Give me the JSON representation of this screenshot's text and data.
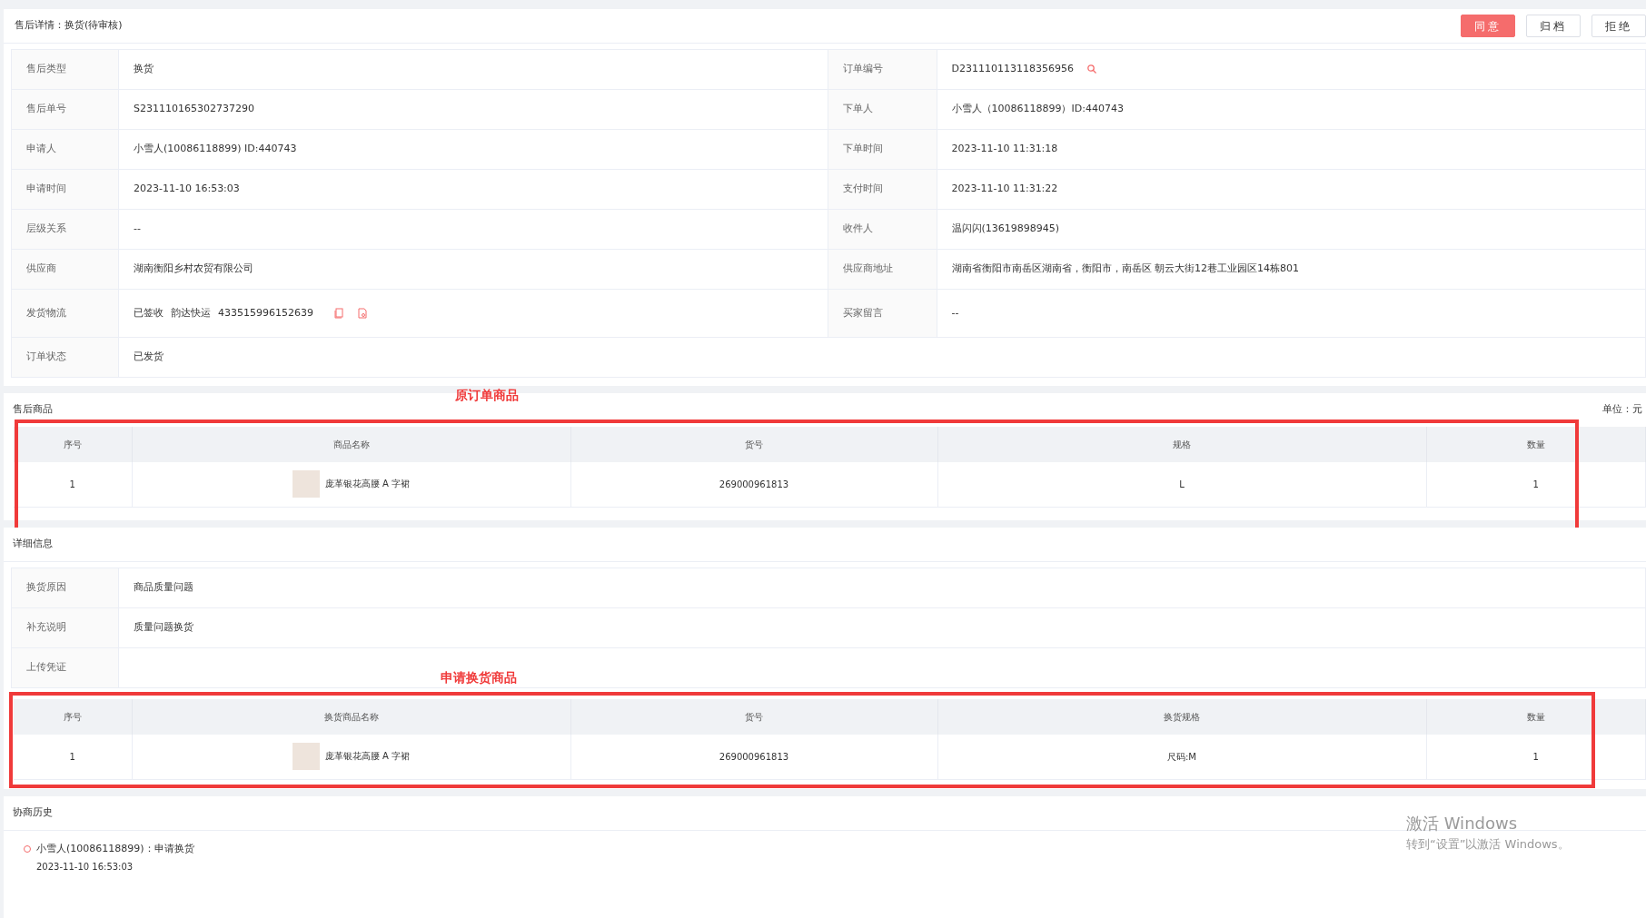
{
  "header": {
    "title": "售后详情：换货(待审核)",
    "buttons": [
      {
        "label": "同意",
        "kind": "primary"
      },
      {
        "label": "归档",
        "kind": "default"
      },
      {
        "label": "拒绝",
        "kind": "default"
      }
    ]
  },
  "info_rows": [
    {
      "cells": [
        {
          "label": "售后类型",
          "value": "换货"
        },
        {
          "label": "订单编号",
          "value": "D231110113118356956",
          "kind": "search"
        }
      ]
    },
    {
      "cells": [
        {
          "label": "售后单号",
          "value": "S231110165302737290"
        },
        {
          "label": "下单人",
          "value": "小雪人（10086118899）ID:440743"
        }
      ]
    },
    {
      "cells": [
        {
          "label": "申请人",
          "value": "小雪人(10086118899) ID:440743"
        },
        {
          "label": "下单时间",
          "value": "2023-11-10 11:31:18"
        }
      ]
    },
    {
      "cells": [
        {
          "label": "申请时间",
          "value": "2023-11-10 16:53:03"
        },
        {
          "label": "支付时间",
          "value": "2023-11-10 11:31:22"
        }
      ]
    },
    {
      "cells": [
        {
          "label": "层级关系",
          "value": "--"
        },
        {
          "label": "收件人",
          "value": "温闪闪(13619898945)"
        }
      ]
    },
    {
      "cells": [
        {
          "label": "供应商",
          "value": "湖南衡阳乡村农贸有限公司"
        },
        {
          "label": "供应商地址",
          "value": "湖南省衡阳市南岳区湖南省，衡阳市，南岳区 朝云大街12巷工业园区14栋801"
        }
      ]
    },
    {
      "cells": [
        {
          "label": "发货物流",
          "kind": "logistics",
          "parts": [
            "已签收",
            "韵达快运",
            "433515996152639"
          ]
        },
        {
          "label": "买家留言",
          "value": "--"
        }
      ]
    },
    {
      "cells": [
        {
          "label": "订单状态",
          "value": "已发货"
        }
      ]
    }
  ],
  "goods": {
    "title": "售后商品",
    "unit": "单位：元",
    "annotation": "原订单商品",
    "columns": [
      "序号",
      "商品名称",
      "货号",
      "规格",
      "数量"
    ],
    "rows": [
      {
        "index": "1",
        "name": "庞革银花高腰 A 字裙",
        "code": "269000961813",
        "spec": "L",
        "qty": "1"
      }
    ]
  },
  "details": {
    "title": "详细信息",
    "rows": [
      {
        "label": "换货原因",
        "value": "商品质量问题"
      },
      {
        "label": "补充说明",
        "value": "质量问题换货"
      },
      {
        "label": "上传凭证",
        "value": ""
      }
    ]
  },
  "exchange": {
    "annotation": "申请换货商品",
    "columns": [
      "序号",
      "换货商品名称",
      "货号",
      "换货规格",
      "数量"
    ],
    "rows": [
      {
        "index": "1",
        "name": "庞革银花高腰 A 字裙",
        "code": "269000961813",
        "spec": "尺码:M",
        "qty": "1"
      }
    ]
  },
  "history": {
    "title": "协商历史",
    "items": [
      {
        "text": "小雪人(10086118899)：申请换货",
        "time": "2023-11-10 16:53:03"
      }
    ]
  },
  "os_notice": {
    "title": "激活 Windows",
    "subtitle": "转到“设置”以激活 Windows。"
  }
}
